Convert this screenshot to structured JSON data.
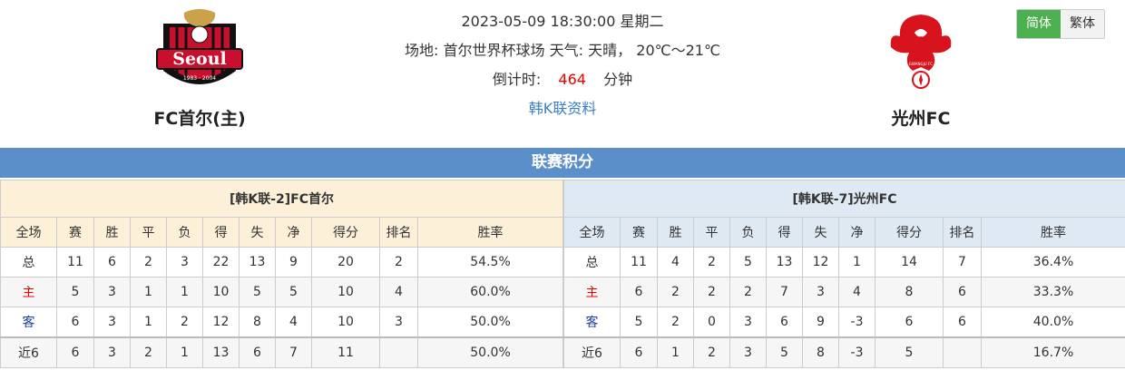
{
  "header": {
    "home_team": "FC首尔(主)",
    "away_team": "光州FC",
    "datetime": "2023-05-09 18:30:00 星期二",
    "venue_label": "场地:",
    "venue": "首尔世界杯球场",
    "weather_label": "天气:",
    "weather": "天晴，",
    "temperature": "20℃～21℃",
    "countdown_label": "倒计时:",
    "countdown_value": "464",
    "countdown_unit": "分钟",
    "league_link": "韩K联资料"
  },
  "lang": {
    "simplified": "简体",
    "traditional": "繁体"
  },
  "section_title": "联赛积分",
  "home_table": {
    "caption": "[韩K联-2]FC首尔",
    "headers": [
      "全场",
      "赛",
      "胜",
      "平",
      "负",
      "得",
      "失",
      "净",
      "得分",
      "排名",
      "胜率"
    ],
    "rows": [
      [
        "总",
        "11",
        "6",
        "2",
        "3",
        "22",
        "13",
        "9",
        "20",
        "2",
        "54.5%"
      ],
      [
        "主",
        "5",
        "3",
        "1",
        "1",
        "10",
        "5",
        "5",
        "10",
        "4",
        "60.0%"
      ],
      [
        "客",
        "6",
        "3",
        "1",
        "2",
        "12",
        "8",
        "4",
        "10",
        "3",
        "50.0%"
      ],
      [
        "近6",
        "6",
        "3",
        "2",
        "1",
        "13",
        "6",
        "7",
        "11",
        "",
        "50.0%"
      ]
    ]
  },
  "away_table": {
    "caption": "[韩K联-7]光州FC",
    "headers": [
      "全场",
      "赛",
      "胜",
      "平",
      "负",
      "得",
      "失",
      "净",
      "得分",
      "排名",
      "胜率"
    ],
    "rows": [
      [
        "总",
        "11",
        "4",
        "2",
        "5",
        "13",
        "12",
        "1",
        "14",
        "7",
        "36.4%"
      ],
      [
        "主",
        "6",
        "2",
        "2",
        "2",
        "7",
        "3",
        "4",
        "8",
        "6",
        "33.3%"
      ],
      [
        "客",
        "5",
        "2",
        "0",
        "3",
        "6",
        "9",
        "-3",
        "6",
        "6",
        "40.0%"
      ],
      [
        "近6",
        "6",
        "1",
        "2",
        "3",
        "5",
        "8",
        "-3",
        "5",
        "",
        "16.7%"
      ]
    ]
  },
  "logos": {
    "home_text": "Seoul",
    "home_years": "1983 · 2004",
    "away_text": "GWANGJU FC"
  },
  "colors": {
    "accent": "#5b8fc9",
    "active_lang": "#4caf50",
    "highlight": "#e00000"
  }
}
